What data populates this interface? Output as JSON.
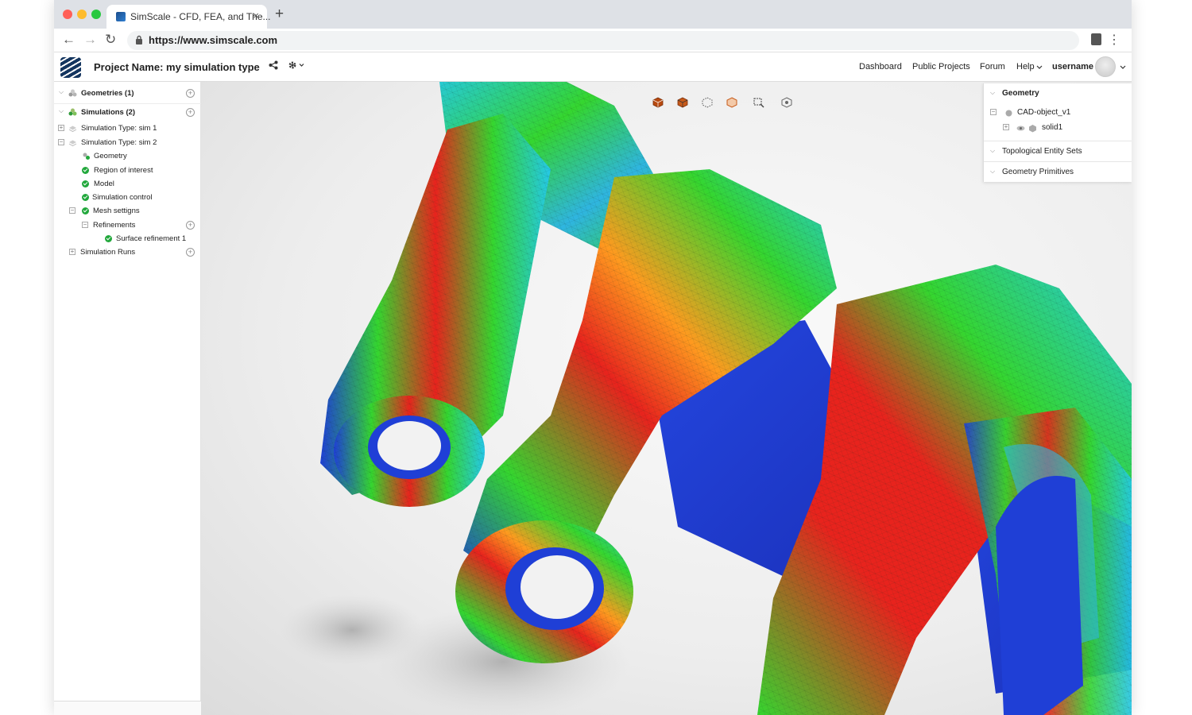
{
  "browser": {
    "tab_title": "SimScale - CFD, FEA, and The...",
    "tab_close": "×",
    "new_tab": "+",
    "url": "https://www.simscale.com",
    "back": "←",
    "forward": "→",
    "reload": "↻",
    "menu": "⋮"
  },
  "header": {
    "project_name": "Project Name: my simulation type",
    "share_icon": "share-icon",
    "settings_icon": "gear-icon",
    "nav": {
      "dashboard": "Dashboard",
      "public_projects": "Public Projects",
      "forum": "Forum",
      "help": "Help",
      "username": "username"
    }
  },
  "tree": {
    "geometries": "Geometries (1)",
    "simulations": "Simulations (2)",
    "sim1": "Simulation Type: sim 1",
    "sim2": "Simulation Type: sim 2",
    "geometry": "Geometry",
    "region": "Region of interest",
    "model": "Model",
    "sim_control": "Simulation control",
    "mesh_settings": "Mesh settigns",
    "refinements": "Refinements",
    "surface_ref": "Surface refinement 1",
    "runs": "Simulation Runs"
  },
  "right_panel": {
    "geometry": "Geometry",
    "cad_object": "CAD-object_v1",
    "solid": "solid1",
    "topological": "Topological Entity Sets",
    "primitives": "Geometry Primitives"
  },
  "colors": {
    "accent": "#14355f",
    "check_green": "#22a83c",
    "stress_high": "#e8231d",
    "stress_mid": "#35d62f",
    "stress_low": "#1f3fd6"
  }
}
